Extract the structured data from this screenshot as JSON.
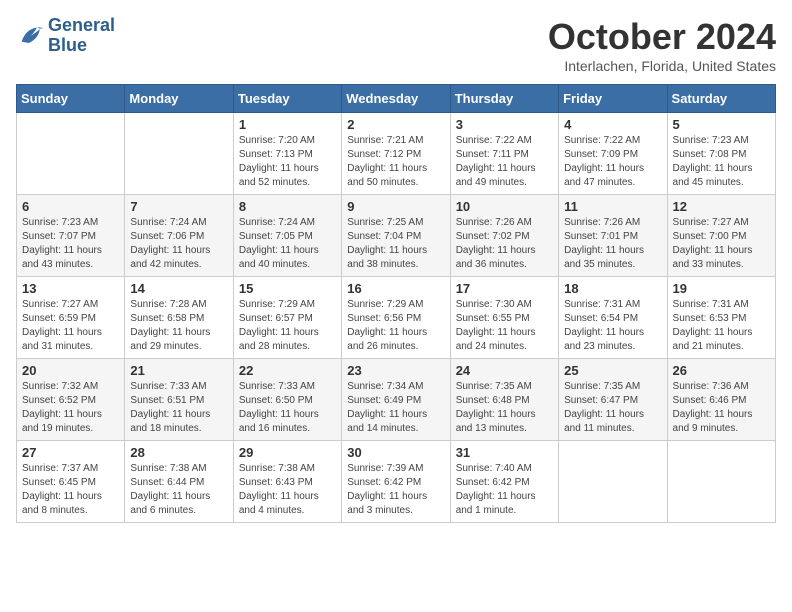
{
  "header": {
    "logo_line1": "General",
    "logo_line2": "Blue",
    "month_title": "October 2024",
    "location": "Interlachen, Florida, United States"
  },
  "days_of_week": [
    "Sunday",
    "Monday",
    "Tuesday",
    "Wednesday",
    "Thursday",
    "Friday",
    "Saturday"
  ],
  "weeks": [
    [
      {
        "day": "",
        "info": ""
      },
      {
        "day": "",
        "info": ""
      },
      {
        "day": "1",
        "info": "Sunrise: 7:20 AM\nSunset: 7:13 PM\nDaylight: 11 hours and 52 minutes."
      },
      {
        "day": "2",
        "info": "Sunrise: 7:21 AM\nSunset: 7:12 PM\nDaylight: 11 hours and 50 minutes."
      },
      {
        "day": "3",
        "info": "Sunrise: 7:22 AM\nSunset: 7:11 PM\nDaylight: 11 hours and 49 minutes."
      },
      {
        "day": "4",
        "info": "Sunrise: 7:22 AM\nSunset: 7:09 PM\nDaylight: 11 hours and 47 minutes."
      },
      {
        "day": "5",
        "info": "Sunrise: 7:23 AM\nSunset: 7:08 PM\nDaylight: 11 hours and 45 minutes."
      }
    ],
    [
      {
        "day": "6",
        "info": "Sunrise: 7:23 AM\nSunset: 7:07 PM\nDaylight: 11 hours and 43 minutes."
      },
      {
        "day": "7",
        "info": "Sunrise: 7:24 AM\nSunset: 7:06 PM\nDaylight: 11 hours and 42 minutes."
      },
      {
        "day": "8",
        "info": "Sunrise: 7:24 AM\nSunset: 7:05 PM\nDaylight: 11 hours and 40 minutes."
      },
      {
        "day": "9",
        "info": "Sunrise: 7:25 AM\nSunset: 7:04 PM\nDaylight: 11 hours and 38 minutes."
      },
      {
        "day": "10",
        "info": "Sunrise: 7:26 AM\nSunset: 7:02 PM\nDaylight: 11 hours and 36 minutes."
      },
      {
        "day": "11",
        "info": "Sunrise: 7:26 AM\nSunset: 7:01 PM\nDaylight: 11 hours and 35 minutes."
      },
      {
        "day": "12",
        "info": "Sunrise: 7:27 AM\nSunset: 7:00 PM\nDaylight: 11 hours and 33 minutes."
      }
    ],
    [
      {
        "day": "13",
        "info": "Sunrise: 7:27 AM\nSunset: 6:59 PM\nDaylight: 11 hours and 31 minutes."
      },
      {
        "day": "14",
        "info": "Sunrise: 7:28 AM\nSunset: 6:58 PM\nDaylight: 11 hours and 29 minutes."
      },
      {
        "day": "15",
        "info": "Sunrise: 7:29 AM\nSunset: 6:57 PM\nDaylight: 11 hours and 28 minutes."
      },
      {
        "day": "16",
        "info": "Sunrise: 7:29 AM\nSunset: 6:56 PM\nDaylight: 11 hours and 26 minutes."
      },
      {
        "day": "17",
        "info": "Sunrise: 7:30 AM\nSunset: 6:55 PM\nDaylight: 11 hours and 24 minutes."
      },
      {
        "day": "18",
        "info": "Sunrise: 7:31 AM\nSunset: 6:54 PM\nDaylight: 11 hours and 23 minutes."
      },
      {
        "day": "19",
        "info": "Sunrise: 7:31 AM\nSunset: 6:53 PM\nDaylight: 11 hours and 21 minutes."
      }
    ],
    [
      {
        "day": "20",
        "info": "Sunrise: 7:32 AM\nSunset: 6:52 PM\nDaylight: 11 hours and 19 minutes."
      },
      {
        "day": "21",
        "info": "Sunrise: 7:33 AM\nSunset: 6:51 PM\nDaylight: 11 hours and 18 minutes."
      },
      {
        "day": "22",
        "info": "Sunrise: 7:33 AM\nSunset: 6:50 PM\nDaylight: 11 hours and 16 minutes."
      },
      {
        "day": "23",
        "info": "Sunrise: 7:34 AM\nSunset: 6:49 PM\nDaylight: 11 hours and 14 minutes."
      },
      {
        "day": "24",
        "info": "Sunrise: 7:35 AM\nSunset: 6:48 PM\nDaylight: 11 hours and 13 minutes."
      },
      {
        "day": "25",
        "info": "Sunrise: 7:35 AM\nSunset: 6:47 PM\nDaylight: 11 hours and 11 minutes."
      },
      {
        "day": "26",
        "info": "Sunrise: 7:36 AM\nSunset: 6:46 PM\nDaylight: 11 hours and 9 minutes."
      }
    ],
    [
      {
        "day": "27",
        "info": "Sunrise: 7:37 AM\nSunset: 6:45 PM\nDaylight: 11 hours and 8 minutes."
      },
      {
        "day": "28",
        "info": "Sunrise: 7:38 AM\nSunset: 6:44 PM\nDaylight: 11 hours and 6 minutes."
      },
      {
        "day": "29",
        "info": "Sunrise: 7:38 AM\nSunset: 6:43 PM\nDaylight: 11 hours and 4 minutes."
      },
      {
        "day": "30",
        "info": "Sunrise: 7:39 AM\nSunset: 6:42 PM\nDaylight: 11 hours and 3 minutes."
      },
      {
        "day": "31",
        "info": "Sunrise: 7:40 AM\nSunset: 6:42 PM\nDaylight: 11 hours and 1 minute."
      },
      {
        "day": "",
        "info": ""
      },
      {
        "day": "",
        "info": ""
      }
    ]
  ]
}
